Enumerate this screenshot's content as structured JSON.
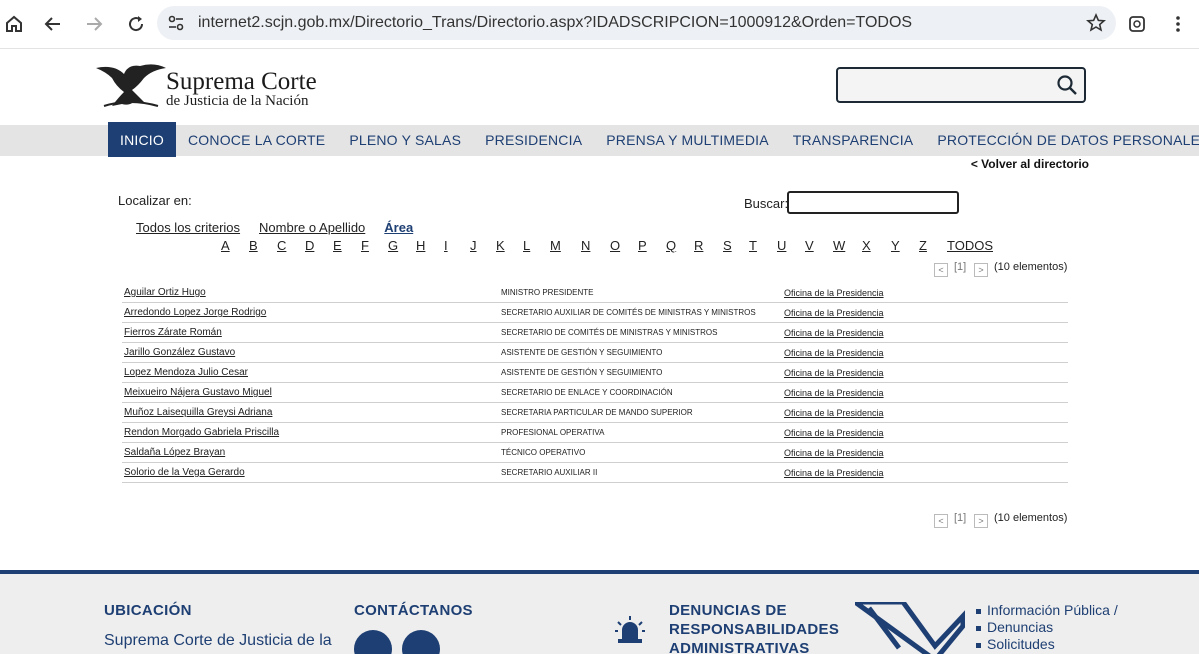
{
  "browser": {
    "url": "internet2.scjn.gob.mx/Directorio_Trans/Directorio.aspx?IDADSCRIPCION=1000912&Orden=TODOS"
  },
  "site": {
    "logo_title": "Suprema Corte",
    "logo_subtitle": "de Justicia de la Nación",
    "search_placeholder": ""
  },
  "nav": {
    "items": [
      "INICIO",
      "CONOCE LA CORTE",
      "PLENO Y SALAS",
      "PRESIDENCIA",
      "PRENSA Y MULTIMEDIA",
      "TRANSPARENCIA",
      "PROTECCIÓN DE DATOS PERSONALES"
    ],
    "active_index": 0
  },
  "directory": {
    "back_link": "< Volver al directorio",
    "locate_label": "Localizar en:",
    "search_label": "Buscar:",
    "criteria": [
      "Todos los criterios",
      "Nombre o Apellido",
      "Área"
    ],
    "selected_criterion": "Área",
    "letters": [
      "A",
      "B",
      "C",
      "D",
      "E",
      "F",
      "G",
      "H",
      "I",
      "J",
      "K",
      "L",
      "M",
      "N",
      "O",
      "P",
      "Q",
      "R",
      "S",
      "T",
      "U",
      "V",
      "W",
      "X",
      "Y",
      "Z",
      "TODOS"
    ],
    "pager": {
      "prev": "<",
      "page": "[1]",
      "next": ">",
      "count": "(10 elementos)"
    },
    "rows": [
      {
        "name": "Aguilar Ortiz Hugo",
        "position": "MINISTRO PRESIDENTE",
        "area": "Oficina de la Presidencia"
      },
      {
        "name": "Arredondo Lopez Jorge Rodrigo",
        "position": "SECRETARIO AUXILIAR DE COMITÉS DE MINISTRAS Y MINISTROS",
        "area": "Oficina de la Presidencia"
      },
      {
        "name": "Fierros Zárate Román",
        "position": "SECRETARIO DE COMITÉS DE MINISTRAS Y MINISTROS",
        "area": "Oficina de la Presidencia"
      },
      {
        "name": "Jarillo González Gustavo",
        "position": "ASISTENTE DE GESTIÓN Y SEGUIMIENTO",
        "area": "Oficina de la Presidencia"
      },
      {
        "name": "Lopez Mendoza Julio Cesar",
        "position": "ASISTENTE DE GESTIÓN Y SEGUIMIENTO",
        "area": "Oficina de la Presidencia"
      },
      {
        "name": "Meixueiro Nájera Gustavo Miguel",
        "position": "SECRETARIO DE ENLACE Y COORDINACIÓN",
        "area": "Oficina de la Presidencia"
      },
      {
        "name": "Muñoz Laisequilla Greysi Adriana",
        "position": "SECRETARIA PARTICULAR DE MANDO SUPERIOR",
        "area": "Oficina de la Presidencia"
      },
      {
        "name": "Rendon Morgado Gabriela Priscilla",
        "position": "PROFESIONAL OPERATIVA",
        "area": "Oficina de la Presidencia"
      },
      {
        "name": "Saldaña López Brayan",
        "position": "TÉCNICO OPERATIVO",
        "area": "Oficina de la Presidencia"
      },
      {
        "name": "Solorio de la Vega Gerardo",
        "position": "SECRETARIO AUXILIAR II",
        "area": "Oficina de la Presidencia"
      }
    ]
  },
  "footer": {
    "ubicacion_title": "UBICACIÓN",
    "ubicacion_text": "Suprema Corte de Justicia de la",
    "contact_title": "CONTÁCTANOS",
    "denuncias_title_1": "DENUNCIAS DE",
    "denuncias_title_2": "RESPONSABILIDADES",
    "denuncias_title_3": "ADMINISTRATIVAS",
    "links": [
      "Información Pública /",
      "Denuncias",
      "Solicitudes"
    ]
  },
  "colors": {
    "brand_blue": "#1e3f73",
    "nav_bg": "#e4e4e4"
  }
}
